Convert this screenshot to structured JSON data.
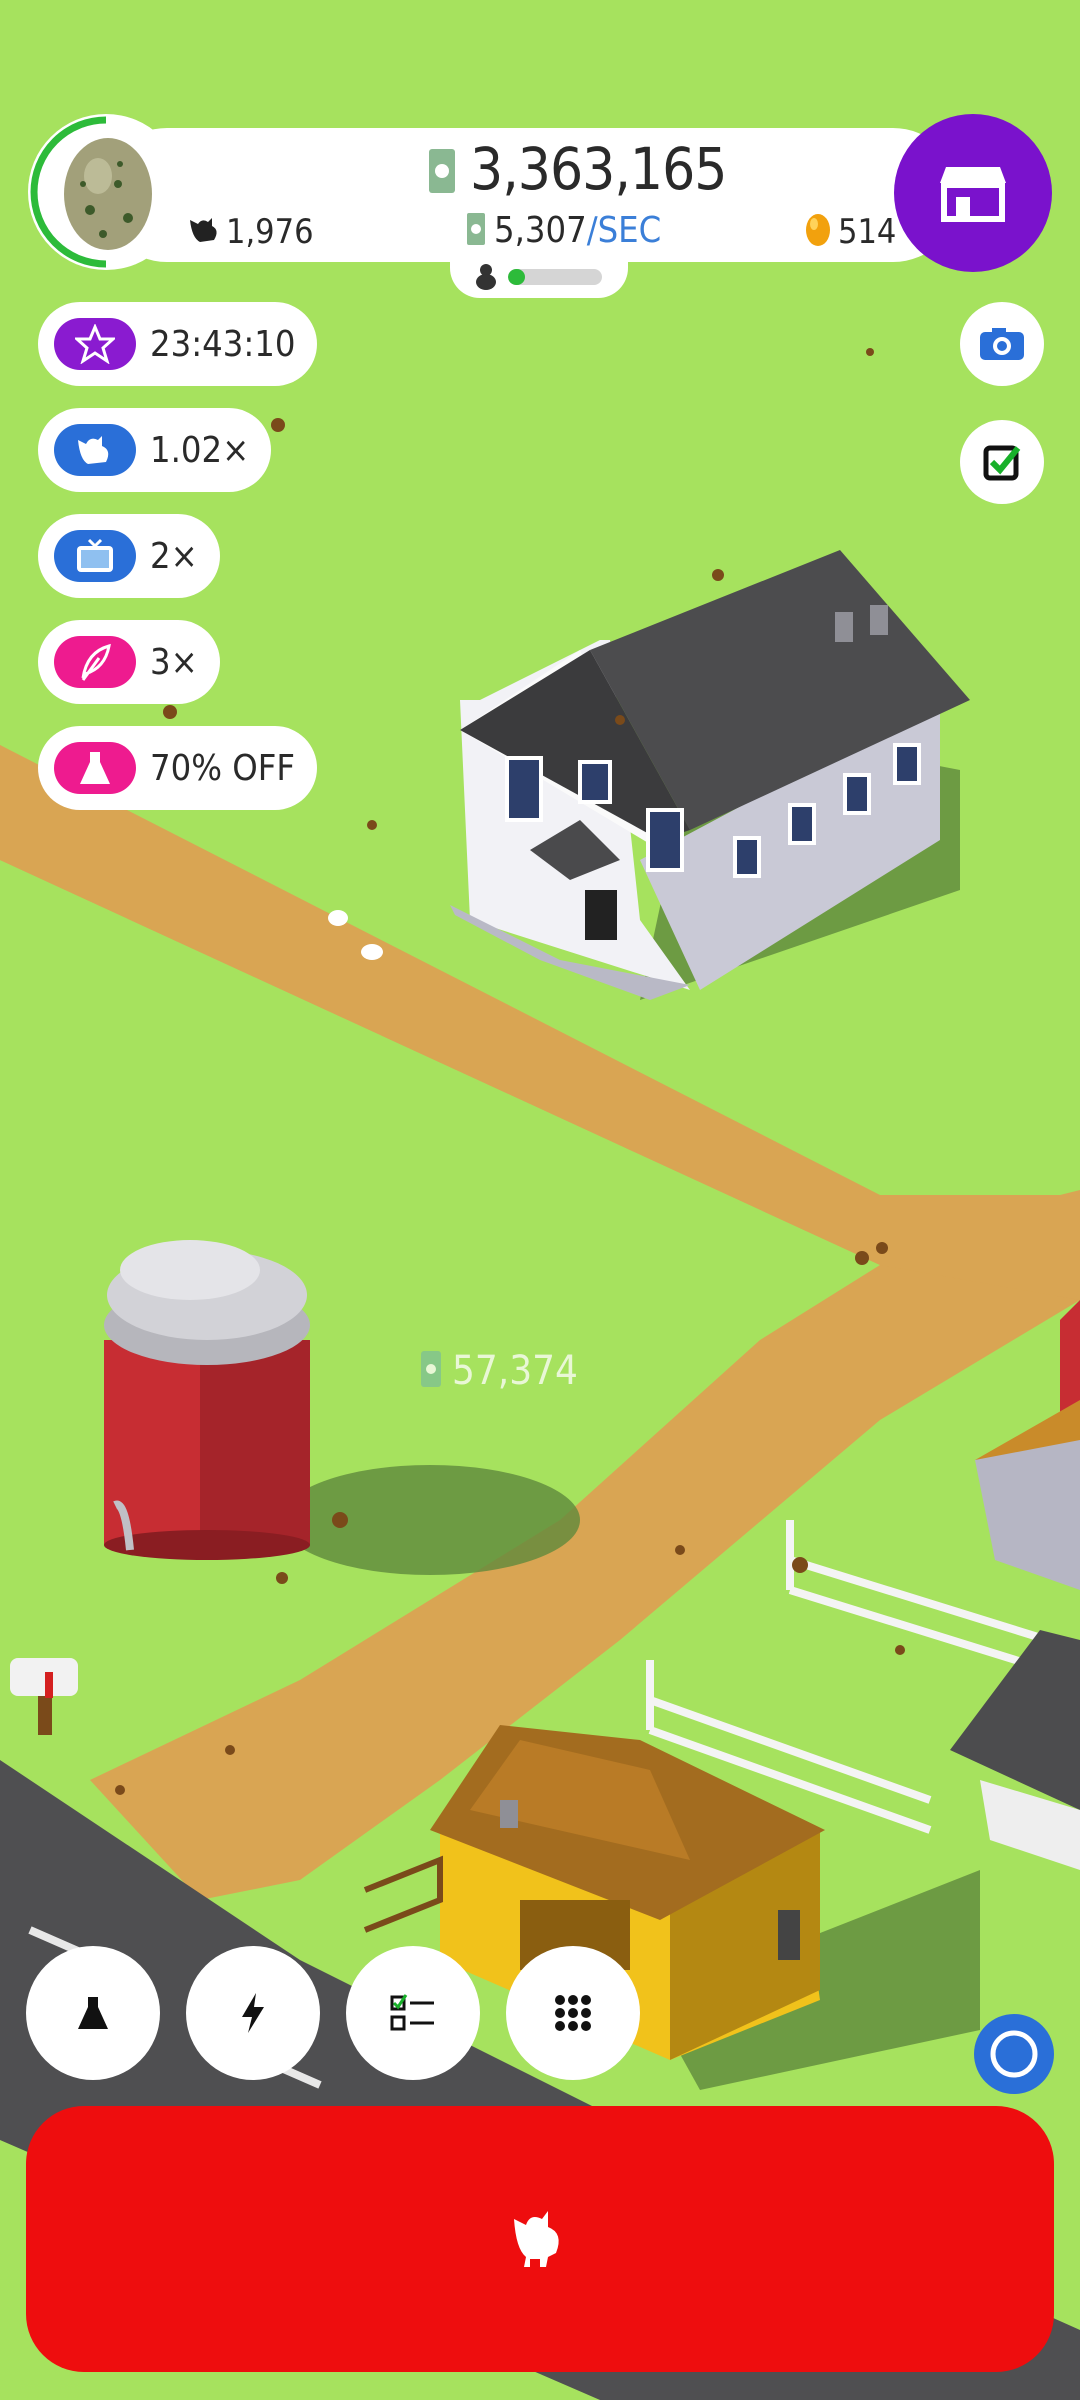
{
  "hud": {
    "money": "3,363,165",
    "rate_value": "5,307",
    "rate_unit": "/SEC",
    "chicken_count": "1,976",
    "egg_count": "514",
    "progress_fraction": 0.18
  },
  "boosts": [
    {
      "icon": "star-icon",
      "label": "23:43:10",
      "color": "#8a1bd0"
    },
    {
      "icon": "chicken-icon",
      "label": "1.02×",
      "color": "#2a6fd8"
    },
    {
      "icon": "tv-icon",
      "label": "2×",
      "color": "#2a6fd8"
    },
    {
      "icon": "feather-icon",
      "label": "3×",
      "color": "#ee1b8f"
    },
    {
      "icon": "flask-icon",
      "label": "70% OFF",
      "color": "#ee1b8f"
    }
  ],
  "floating_income": "57,374",
  "actions": [
    {
      "icon": "flask-icon"
    },
    {
      "icon": "lightning-icon"
    },
    {
      "icon": "checklist-icon"
    },
    {
      "icon": "grid-icon"
    }
  ],
  "colors": {
    "grass": "#a6e25e",
    "road": "#d9a553",
    "shop": "#7a12cc",
    "hatch_button": "#ee0d0e"
  }
}
